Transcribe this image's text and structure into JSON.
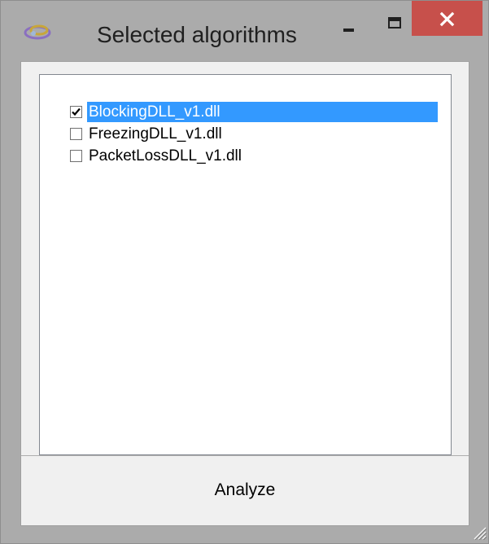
{
  "window": {
    "title": "Selected algorithms"
  },
  "icons": {
    "app": "app-logo-icon",
    "minimize": "minimize-icon",
    "maximize": "maximize-icon",
    "close": "close-icon",
    "check": "check-icon",
    "grip": "resize-grip-icon"
  },
  "colors": {
    "close_button": "#c7504b",
    "selection": "#3399ff",
    "window_frame": "#ababab",
    "client_background": "#f0f0f0"
  },
  "list": {
    "items": [
      {
        "label": "BlockingDLL_v1.dll",
        "checked": true,
        "selected": true
      },
      {
        "label": "FreezingDLL_v1.dll",
        "checked": false,
        "selected": false
      },
      {
        "label": "PacketLossDLL_v1.dll",
        "checked": false,
        "selected": false
      }
    ]
  },
  "actions": {
    "analyze_label": "Analyze"
  }
}
